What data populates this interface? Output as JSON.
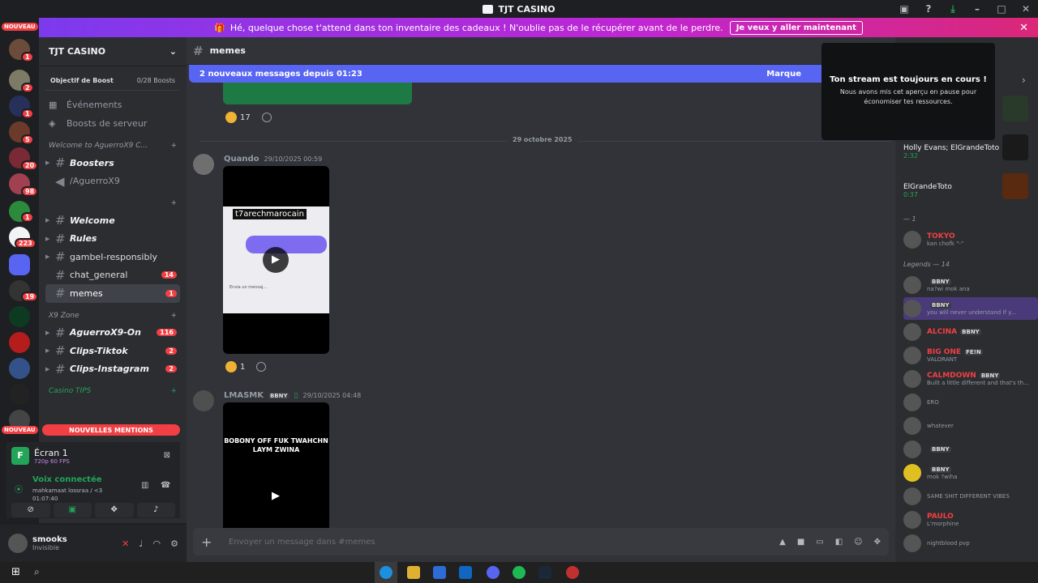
{
  "window": {
    "title": "TJT CASINO"
  },
  "banner": {
    "text": "Hé, quelque chose t'attend dans ton inventaire des cadeaux ! N'oublie pas de le récupérer avant de le perdre.",
    "button": "Je veux y aller maintenant"
  },
  "server_rail": {
    "new_label": "NOUVEAU",
    "badges": [
      "1",
      "2",
      "1",
      "5",
      "20",
      "98",
      "1",
      "223",
      "19"
    ]
  },
  "sidebar": {
    "guild_name": "TJT CASINO",
    "boost_label": "Objectif de Boost",
    "boost_count": "0/28 Boosts",
    "nav": [
      {
        "label": "Événements"
      },
      {
        "label": "Boosts de serveur"
      }
    ],
    "categories": [
      {
        "name": "Welcome to AguerroX9 C...",
        "channels": [
          {
            "name": "Boosters",
            "style": "bold"
          },
          {
            "name": "/AguerroX9",
            "style": "voice"
          }
        ]
      },
      {
        "name": "",
        "channels": [
          {
            "name": "Welcome",
            "style": "bold"
          },
          {
            "name": "Rules",
            "style": "bold"
          },
          {
            "name": "gambel-responsibly",
            "style": "plain"
          },
          {
            "name": "chat_general",
            "style": "plain",
            "badge": "14"
          },
          {
            "name": "memes",
            "style": "active",
            "badge": "1"
          }
        ]
      },
      {
        "name": "X9 Zone",
        "channels": [
          {
            "name": "AguerroX9-On",
            "style": "bold",
            "badge": "116"
          },
          {
            "name": "Clips-Tiktok",
            "style": "bold",
            "badge": "2"
          },
          {
            "name": "Clips-Instagram",
            "style": "bold",
            "badge": "2"
          }
        ]
      },
      {
        "name": "Casino TIPS",
        "channels": []
      }
    ],
    "mentions_label": "NOUVELLES MENTIONS",
    "new_label": "NOUVEAU"
  },
  "stream": {
    "screen_name": "Écran 1",
    "quality": "720p 60 FPS",
    "voice_status": "Voix connectée",
    "voice_channel": "mahkamaat lossraa / <3",
    "timer": "01:07:40"
  },
  "user": {
    "name": "smooks",
    "status": "Invisible"
  },
  "chat": {
    "channel": "memes",
    "new_messages": "2 nouveaux messages depuis 01:23",
    "mark_read": "Marque",
    "first_reaction_count": "17",
    "date_divider": "29 octobre 2025",
    "messages": [
      {
        "author": "Quando",
        "time": "29/10/2025 00:59",
        "video_title": "t7arechmarocain",
        "video_input": "Envia un mensaj...",
        "reaction_count": "1"
      },
      {
        "author": "LMASMK",
        "tag": "BBNY",
        "time": "29/10/2025 04:48",
        "video_text": "BOBONY OFF FUK TWAHCHN LAYM ZWINA"
      }
    ],
    "composer_placeholder": "Envoyer un message dans #memes"
  },
  "stream_popup": {
    "title": "Ton stream est toujours en cours !",
    "body": "Nous avons mis cet aperçu en pause pour économiser tes ressources."
  },
  "members": {
    "activities": [
      {
        "names": "Holly Evans; ElGrandeToto",
        "time": "2:32"
      },
      {
        "names": "ElGrandeToto",
        "time": "0:37"
      }
    ],
    "group1_label": "— 1",
    "group1": [
      {
        "name": "TOKYO",
        "sub": "kan chofk \"-\""
      }
    ],
    "legends_label": "Legends — 14",
    "legends": [
      {
        "name": "",
        "tag": "BBNY",
        "sub": "na?wi mok ana"
      },
      {
        "name": "",
        "tag": "BBNY",
        "sub": "you will never understand if y..."
      },
      {
        "name": "ALCINA",
        "tag": "BBNY",
        "sub": ""
      },
      {
        "name": "BIG ONE",
        "tag": "FE!N",
        "sub": "VALORANT"
      },
      {
        "name": "CALMDOWN",
        "tag": "BBNY",
        "sub": "Built a little different and that's th..."
      },
      {
        "name": "",
        "tag": "",
        "sub": "ERO"
      },
      {
        "name": "",
        "tag": "",
        "sub": "whatever"
      },
      {
        "name": "",
        "tag": "BBNY",
        "sub": ""
      },
      {
        "name": "",
        "tag": "BBNY",
        "sub": "mok ?wiha"
      },
      {
        "name": "",
        "tag": "",
        "sub": "SAME SHIT DIFFERENT VIBES"
      },
      {
        "name": "PAULO",
        "tag": "",
        "sub": "L'morphine"
      },
      {
        "name": "",
        "tag": "",
        "sub": "nightblood pvp"
      }
    ]
  }
}
